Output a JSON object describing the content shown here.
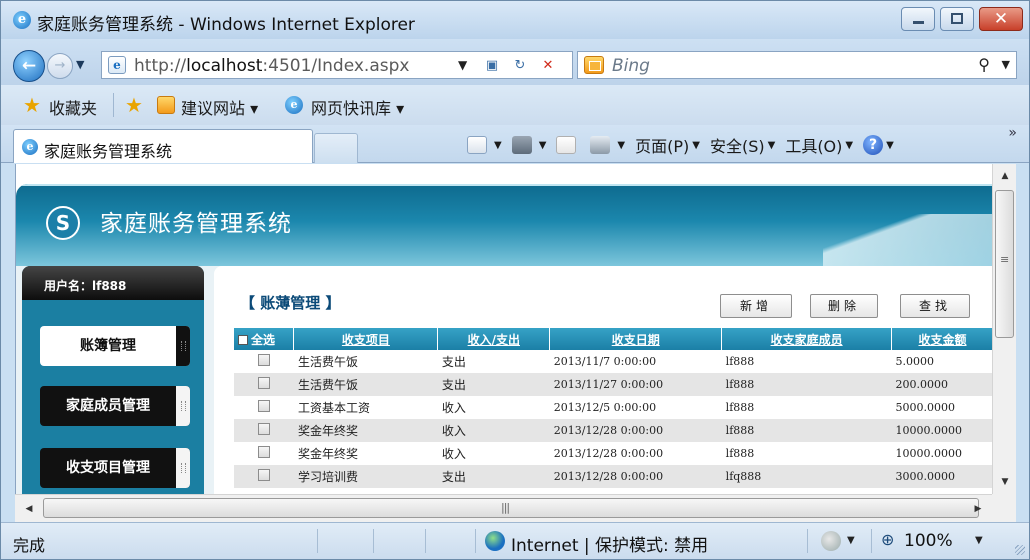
{
  "window": {
    "title": "家庭账务管理系统 - Windows Internet Explorer",
    "close_glyph": "✕"
  },
  "address_bar": {
    "url_prefix": "http://",
    "url_host": "localhost",
    "url_rest": ":4501/Index.aspx",
    "search_placeholder": "Bing"
  },
  "favorites_bar": {
    "favorites_label": "收藏夹",
    "suggested_sites_label": "建议网站 ▾",
    "web_slice_label": "网页快讯库 ▾"
  },
  "tab": {
    "label": "家庭账务管理系统"
  },
  "command_bar": {
    "page_label": "页面(P)",
    "safety_label": "安全(S)",
    "tools_label": "工具(O)",
    "help_glyph": "?",
    "chevron": "»"
  },
  "app": {
    "title": "家庭账务管理系统",
    "user_label": "用户名：lf888",
    "menu": [
      {
        "label": "账簿管理",
        "active": true
      },
      {
        "label": "家庭成员管理",
        "active": false
      },
      {
        "label": "收支项目管理",
        "active": false
      }
    ],
    "section_title": "【 账薄管理 】",
    "buttons": {
      "add": "新增",
      "delete": "删除",
      "search": "查找"
    },
    "table": {
      "headers": {
        "select_all": "全选",
        "item": "收支项目",
        "type": "收入/支出",
        "date": "收支日期",
        "member": "收支家庭成员",
        "amount": "收支金额"
      },
      "rows": [
        {
          "item": "生活费午饭",
          "type": "支出",
          "date": "2013/11/7 0:00:00",
          "member": "lf888",
          "amount": "5.0000"
        },
        {
          "item": "生活费午饭",
          "type": "支出",
          "date": "2013/11/27 0:00:00",
          "member": "lf888",
          "amount": "200.0000"
        },
        {
          "item": "工资基本工资",
          "type": "收入",
          "date": "2013/12/5 0:00:00",
          "member": "lf888",
          "amount": "5000.0000"
        },
        {
          "item": "奖金年终奖",
          "type": "收入",
          "date": "2013/12/28 0:00:00",
          "member": "lf888",
          "amount": "10000.0000"
        },
        {
          "item": "奖金年终奖",
          "type": "收入",
          "date": "2013/12/28 0:00:00",
          "member": "lf888",
          "amount": "10000.0000"
        },
        {
          "item": "学习培训费",
          "type": "支出",
          "date": "2013/12/28 0:00:00",
          "member": "lfq888",
          "amount": "3000.0000"
        }
      ]
    }
  },
  "status_bar": {
    "status": "完成",
    "zone": "Internet | 保护模式: 禁用",
    "zoom": "100%"
  },
  "colors": {
    "accent": "#1b7fa6",
    "banner": "#0e6a8e",
    "section_title": "#0b4a78"
  }
}
